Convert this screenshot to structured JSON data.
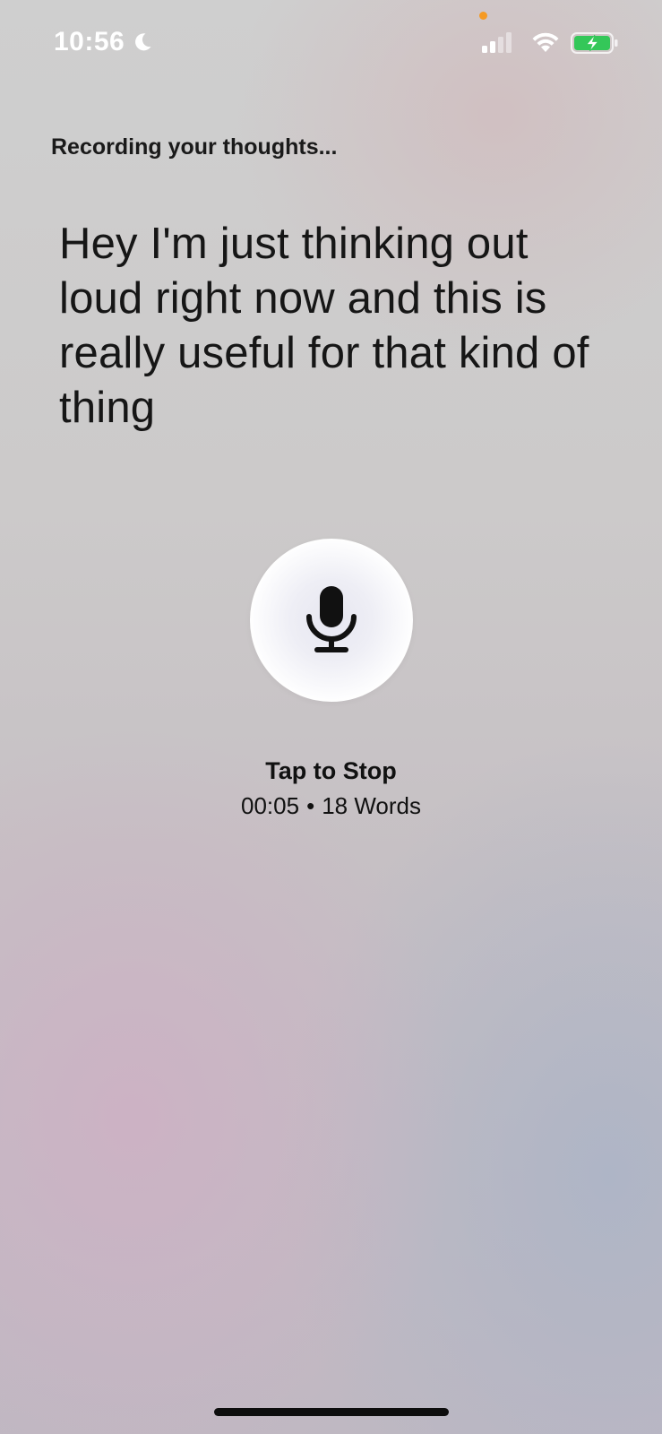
{
  "status_bar": {
    "time": "10:56",
    "focus_mode_icon": "moon-icon",
    "signal_icon": "cellular-signal-icon",
    "wifi_icon": "wifi-icon",
    "battery_icon": "battery-charging-icon",
    "privacy_indicator_color": "#f59a23",
    "battery_color": "#34c759"
  },
  "recording": {
    "status_label": "Recording your thoughts...",
    "transcript": "Hey I'm just thinking out loud right now and this is really useful for that kind of thing"
  },
  "controls": {
    "mic_icon": "microphone-icon",
    "tap_label": "Tap to Stop",
    "elapsed_time": "00:05",
    "separator": "•",
    "word_count": "18 Words"
  }
}
